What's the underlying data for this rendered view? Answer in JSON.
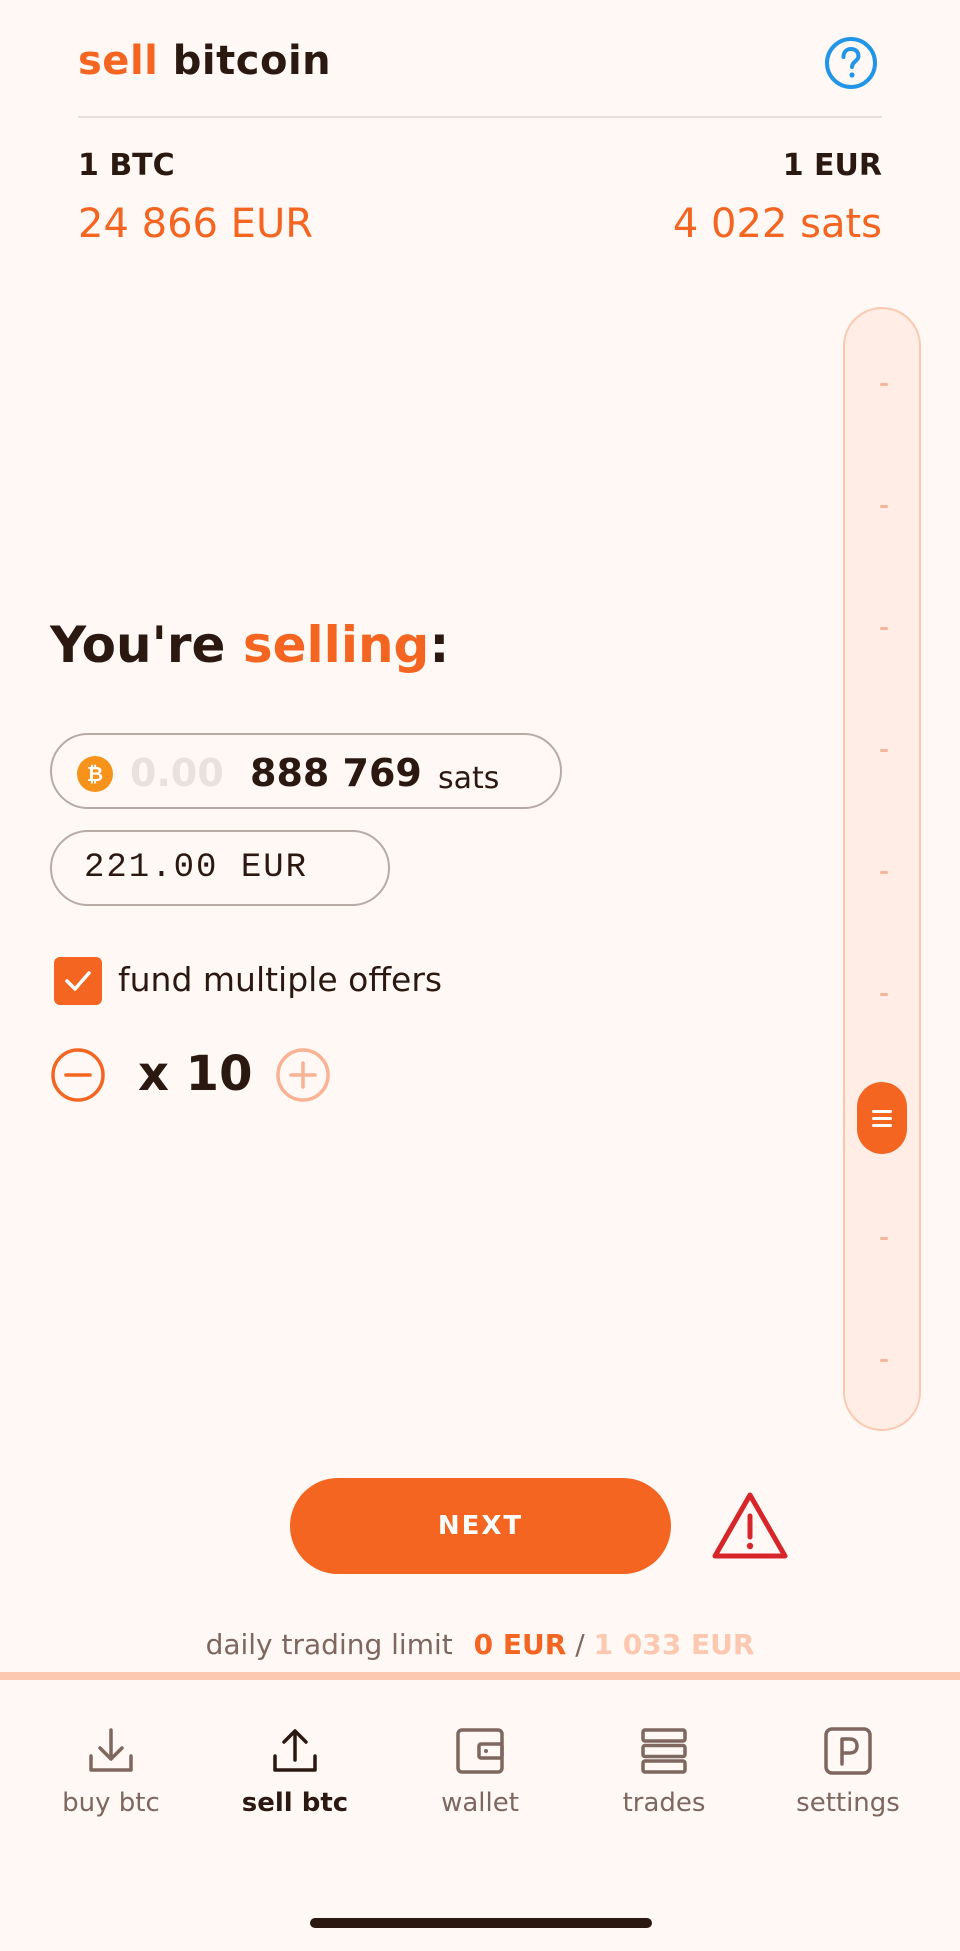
{
  "header": {
    "title_accent": "sell",
    "title_rest": "bitcoin"
  },
  "prices": {
    "left_label": "1 BTC",
    "left_value": "24 866 EUR",
    "right_label": "1 EUR",
    "right_value": "4 022 sats"
  },
  "slider": {
    "level": 0.72
  },
  "selling": {
    "title_prefix": "You're",
    "title_accent": "selling",
    "title_suffix": ":",
    "sats_zero": "0.00",
    "sats_amount": "888 769",
    "sats_unit": "sats",
    "eur_amount": "221.00 EUR"
  },
  "multi": {
    "checked": true,
    "label": "fund multiple offers",
    "count": "x 10"
  },
  "actions": {
    "next_label": "NEXT"
  },
  "limit": {
    "label": "daily trading limit",
    "used": "0 EUR",
    "separator": "/",
    "total": "1 033 EUR"
  },
  "nav": {
    "items": [
      {
        "label": "buy btc",
        "icon": "download-icon"
      },
      {
        "label": "sell btc",
        "icon": "upload-icon"
      },
      {
        "label": "wallet",
        "icon": "wallet-icon"
      },
      {
        "label": "trades",
        "icon": "stack-icon"
      },
      {
        "label": "settings",
        "icon": "settings-icon"
      }
    ]
  },
  "colors": {
    "accent": "#F56522",
    "background": "#FFF8F5",
    "help": "#2196E8",
    "warning": "#D7262A"
  }
}
